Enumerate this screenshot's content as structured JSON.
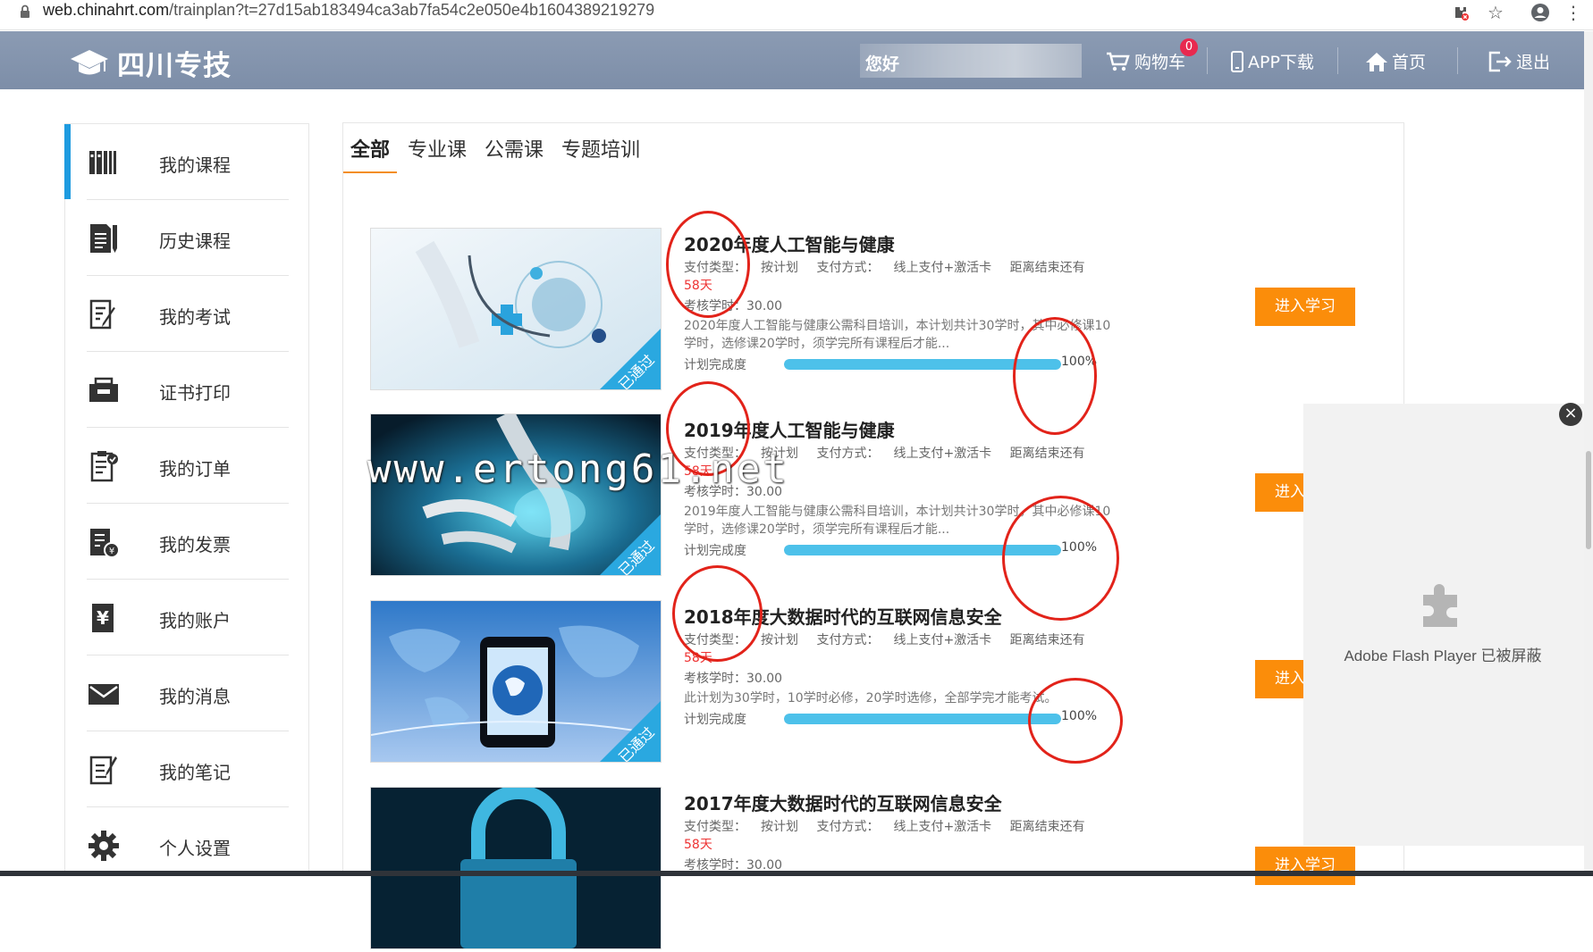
{
  "browser": {
    "url_domain": "web.chinahrt.com",
    "url_path": "/trainplan?t=27d15ab183494ca3ab7fa54c2e050e4b1604389219279"
  },
  "header": {
    "logo_text": "四川专技",
    "welcome": "您好",
    "cart_label": "购物车",
    "cart_count": "0",
    "app_label": "APP下载",
    "home_label": "首页",
    "logout_label": "退出"
  },
  "sidebar": {
    "items": [
      {
        "label": "我的课程",
        "icon": "books-icon"
      },
      {
        "label": "历史课程",
        "icon": "document-pen-icon"
      },
      {
        "label": "我的考试",
        "icon": "exam-icon"
      },
      {
        "label": "证书打印",
        "icon": "printer-icon"
      },
      {
        "label": "我的订单",
        "icon": "clipboard-check-icon"
      },
      {
        "label": "我的发票",
        "icon": "invoice-icon"
      },
      {
        "label": "我的账户",
        "icon": "yen-icon"
      },
      {
        "label": "我的消息",
        "icon": "mail-icon"
      },
      {
        "label": "我的笔记",
        "icon": "notebook-icon"
      },
      {
        "label": "个人设置",
        "icon": "gear-icon"
      }
    ]
  },
  "tabs": [
    "全部",
    "专业课",
    "公需课",
    "专题培训"
  ],
  "courses": [
    {
      "title": "2020年度人工智能与健康",
      "pay_type_label": "支付类型：",
      "pay_type": "按计划",
      "pay_method_label": "支付方式：",
      "pay_method": "线上支付+激活卡",
      "remaining_label": "距离结束还有",
      "days": "58天",
      "hours": "考核学时：30.00",
      "desc": "2020年度人工智能与健康公需科目培训，本计划共计30学时，其中必修课10学时，选修课20学时，须学完所有课程后才能...",
      "progress_label": "计划完成度",
      "progress": 100,
      "progress_text": "100%",
      "badge": "已通过",
      "button": "进入学习"
    },
    {
      "title": "2019年度人工智能与健康",
      "pay_type_label": "支付类型：",
      "pay_type": "按计划",
      "pay_method_label": "支付方式：",
      "pay_method": "线上支付+激活卡",
      "remaining_label": "距离结束还有",
      "days": "58天",
      "hours": "考核学时：30.00",
      "desc": "2019年度人工智能与健康公需科目培训，本计划共计30学时，其中必修课10学时，选修课20学时，须学完所有课程后才能...",
      "progress_label": "计划完成度",
      "progress": 100,
      "progress_text": "100%",
      "badge": "已通过",
      "button": "进入学习"
    },
    {
      "title": "2018年度大数据时代的互联网信息安全",
      "pay_type_label": "支付类型：",
      "pay_type": "按计划",
      "pay_method_label": "支付方式：",
      "pay_method": "线上支付+激活卡",
      "remaining_label": "距离结束还有",
      "days": "58天",
      "hours": "考核学时：30.00",
      "desc": "此计划为30学时，10学时必修，20学时选修，全部学完才能考试。",
      "progress_label": "计划完成度",
      "progress": 100,
      "progress_text": "100%",
      "badge": "已通过",
      "button": "进入学习"
    },
    {
      "title": "2017年度大数据时代的互联网信息安全",
      "pay_type_label": "支付类型：",
      "pay_type": "按计划",
      "pay_method_label": "支付方式：",
      "pay_method": "线上支付+激活卡",
      "remaining_label": "距离结束还有",
      "days": "58天",
      "hours": "考核学时：30.00",
      "button": "进入学习"
    }
  ],
  "flash": {
    "message": "Adobe Flash Player 已被屏蔽",
    "close": "×"
  },
  "watermark": "www.ertong61.net",
  "colors": {
    "header_bg": "#8394ad",
    "accent": "#1e9be0",
    "button": "#fb8d0a",
    "progress": "#4dc1ea",
    "annotation": "#e2231a"
  }
}
